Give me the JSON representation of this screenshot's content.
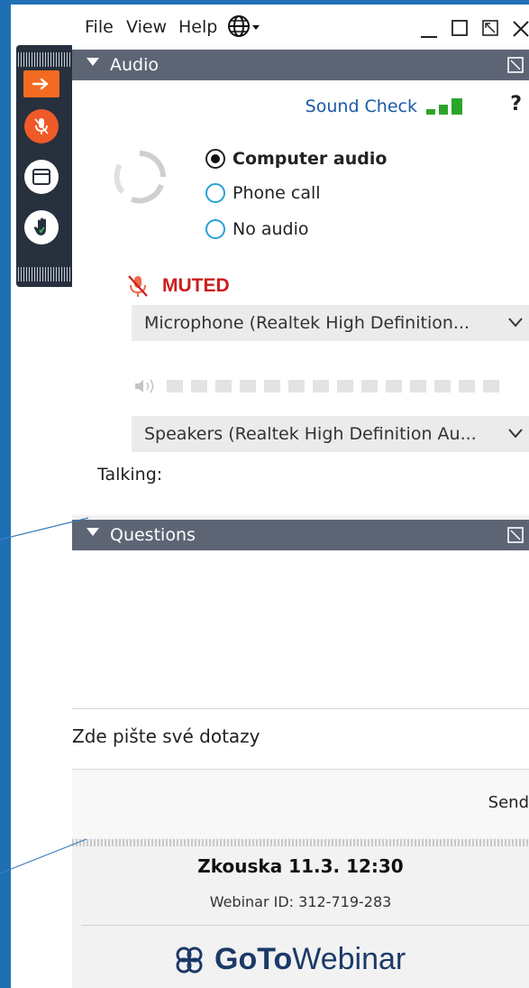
{
  "menu": {
    "file": "File",
    "view": "View",
    "help": "Help"
  },
  "audio": {
    "header": "Audio",
    "sound_check": "Sound Check",
    "options": [
      {
        "label": "Computer audio",
        "checked": true
      },
      {
        "label": "Phone call",
        "checked": false
      },
      {
        "label": "No audio",
        "checked": false
      }
    ],
    "muted_label": "MUTED",
    "microphone": "Microphone (Realtek High Definition...",
    "speakers": "Speakers (Realtek High Definition Au...",
    "talking_label": "Talking:"
  },
  "questions": {
    "header": "Questions",
    "placeholder": "Zde pište své dotazy",
    "send_label": "Send"
  },
  "footer": {
    "webinar_title": "Zkouska 11.3. 12:30",
    "webinar_id": "Webinar ID: 312-719-283",
    "brand_bold": "GoTo",
    "brand_light": "Webinar"
  },
  "colors": {
    "accent_orange": "#f36b21",
    "muted_red": "#cc1d1d",
    "header_gray": "#5d6575",
    "signal_green": "#2aa52a",
    "link_blue": "#1a5aa6"
  }
}
